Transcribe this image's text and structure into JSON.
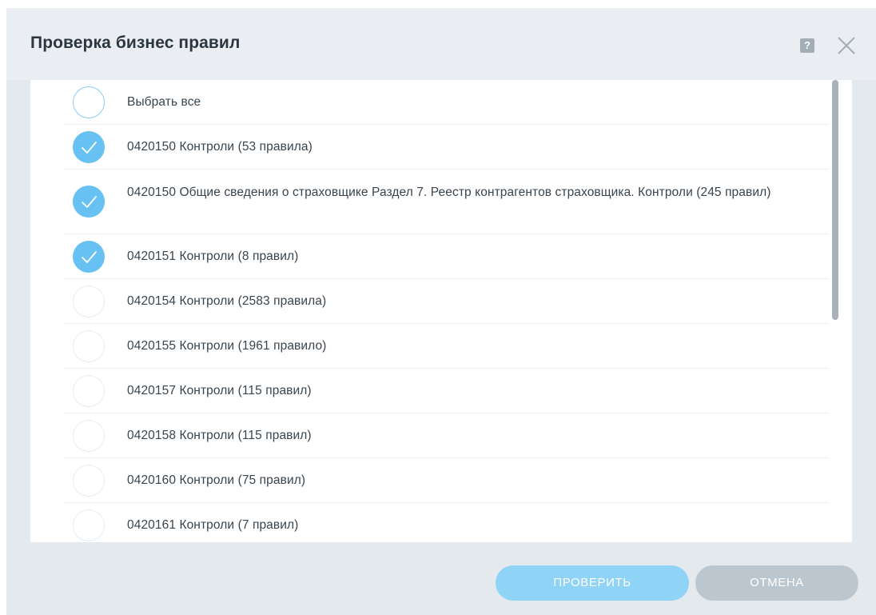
{
  "dialog": {
    "title": "Проверка бизнес правил",
    "help_icon": "question-icon",
    "help_glyph": "?",
    "close_icon": "close-icon"
  },
  "rules": {
    "select_all": {
      "label": "Выбрать все",
      "checked": false
    },
    "items": [
      {
        "label": "0420150 Контроли (53 правила)",
        "checked": true
      },
      {
        "label": "0420150 Общие сведения о страховщике Раздел 7. Реестр контрагентов страховщика. Контроли (245 правил)",
        "checked": true
      },
      {
        "label": "0420151 Контроли (8 правил)",
        "checked": true
      },
      {
        "label": "0420154 Контроли (2583 правила)",
        "checked": false
      },
      {
        "label": "0420155 Контроли (1961 правило)",
        "checked": false
      },
      {
        "label": "0420157 Контроли (115 правил)",
        "checked": false
      },
      {
        "label": "0420158 Контроли (115 правил)",
        "checked": false
      },
      {
        "label": "0420160 Контроли (75 правил)",
        "checked": false
      },
      {
        "label": "0420161 Контроли (7 правил)",
        "checked": false
      }
    ]
  },
  "footer": {
    "check_button": "ПРОВЕРИТЬ",
    "cancel_button": "ОТМЕНА"
  },
  "colors": {
    "accent": "#67c1f3",
    "check_button": "#8fd3f7",
    "cancel_button": "#bcc6ce",
    "dialog_background": "#e4e9ee"
  }
}
